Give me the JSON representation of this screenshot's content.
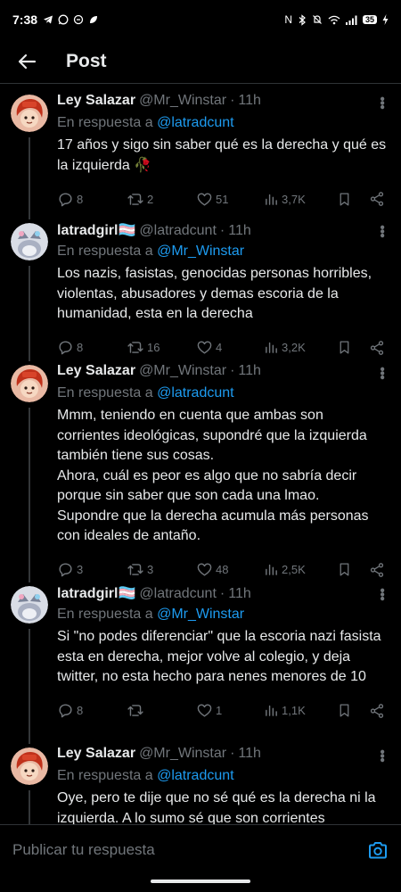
{
  "status_bar": {
    "time": "7:38",
    "battery": "35"
  },
  "header": {
    "title": "Post"
  },
  "reply_prefix": "En respuesta a",
  "tweets": [
    {
      "name": "Ley Salazar",
      "handle": "@Mr_Winstar",
      "time": "11h",
      "reply_to": "@latradcunt",
      "text": "17 años y sigo sin saber qué es la derecha y qué es la izquierda 🥀",
      "replies": "8",
      "retweets": "2",
      "likes": "51",
      "views": "3,7K"
    },
    {
      "name": "latradgirl🏳️‍⚧️",
      "handle": "@latradcunt",
      "time": "11h",
      "reply_to": "@Mr_Winstar",
      "text": "Los nazis, fasistas, genocidas personas horribles, violentas, abusadores y demas escoria de la humanidad, esta en la derecha",
      "replies": "8",
      "retweets": "16",
      "likes": "4",
      "views": "3,2K"
    },
    {
      "name": "Ley Salazar",
      "handle": "@Mr_Winstar",
      "time": "11h",
      "reply_to": "@latradcunt",
      "text": "Mmm, teniendo en cuenta que ambas son corrientes ideológicas, supondré que la izquierda también tiene sus cosas.\nAhora, cuál es peor es algo que no sabría decir porque sin saber que son cada una lmao.\nSupondre que la derecha acumula más personas con ideales de antaño.",
      "replies": "3",
      "retweets": "3",
      "likes": "48",
      "views": "2,5K"
    },
    {
      "name": "latradgirl🏳️‍⚧️",
      "handle": "@latradcunt",
      "time": "11h",
      "reply_to": "@Mr_Winstar",
      "text": "Si \"no podes diferenciar\" que la escoria nazi fasista esta en derecha, mejor volve al colegio, y deja twitter, no esta hecho para nenes menores de 10",
      "replies": "8",
      "retweets": "",
      "likes": "1",
      "views": "1,1K"
    },
    {
      "name": "Ley Salazar",
      "handle": "@Mr_Winstar",
      "time": "11h",
      "reply_to": "@latradcunt",
      "text": "Oye, pero te dije que no sé qué es la derecha ni la izquierda. A lo sumo sé que son corrientes",
      "replies": "",
      "retweets": "",
      "likes": "",
      "views": ""
    }
  ],
  "reply_bar": {
    "placeholder": "Publicar tu respuesta"
  },
  "colors": {
    "background": "#000000",
    "text": "#e7e9ea",
    "muted": "#71767b",
    "accent": "#1d9bf0",
    "divider": "#2f3336"
  }
}
